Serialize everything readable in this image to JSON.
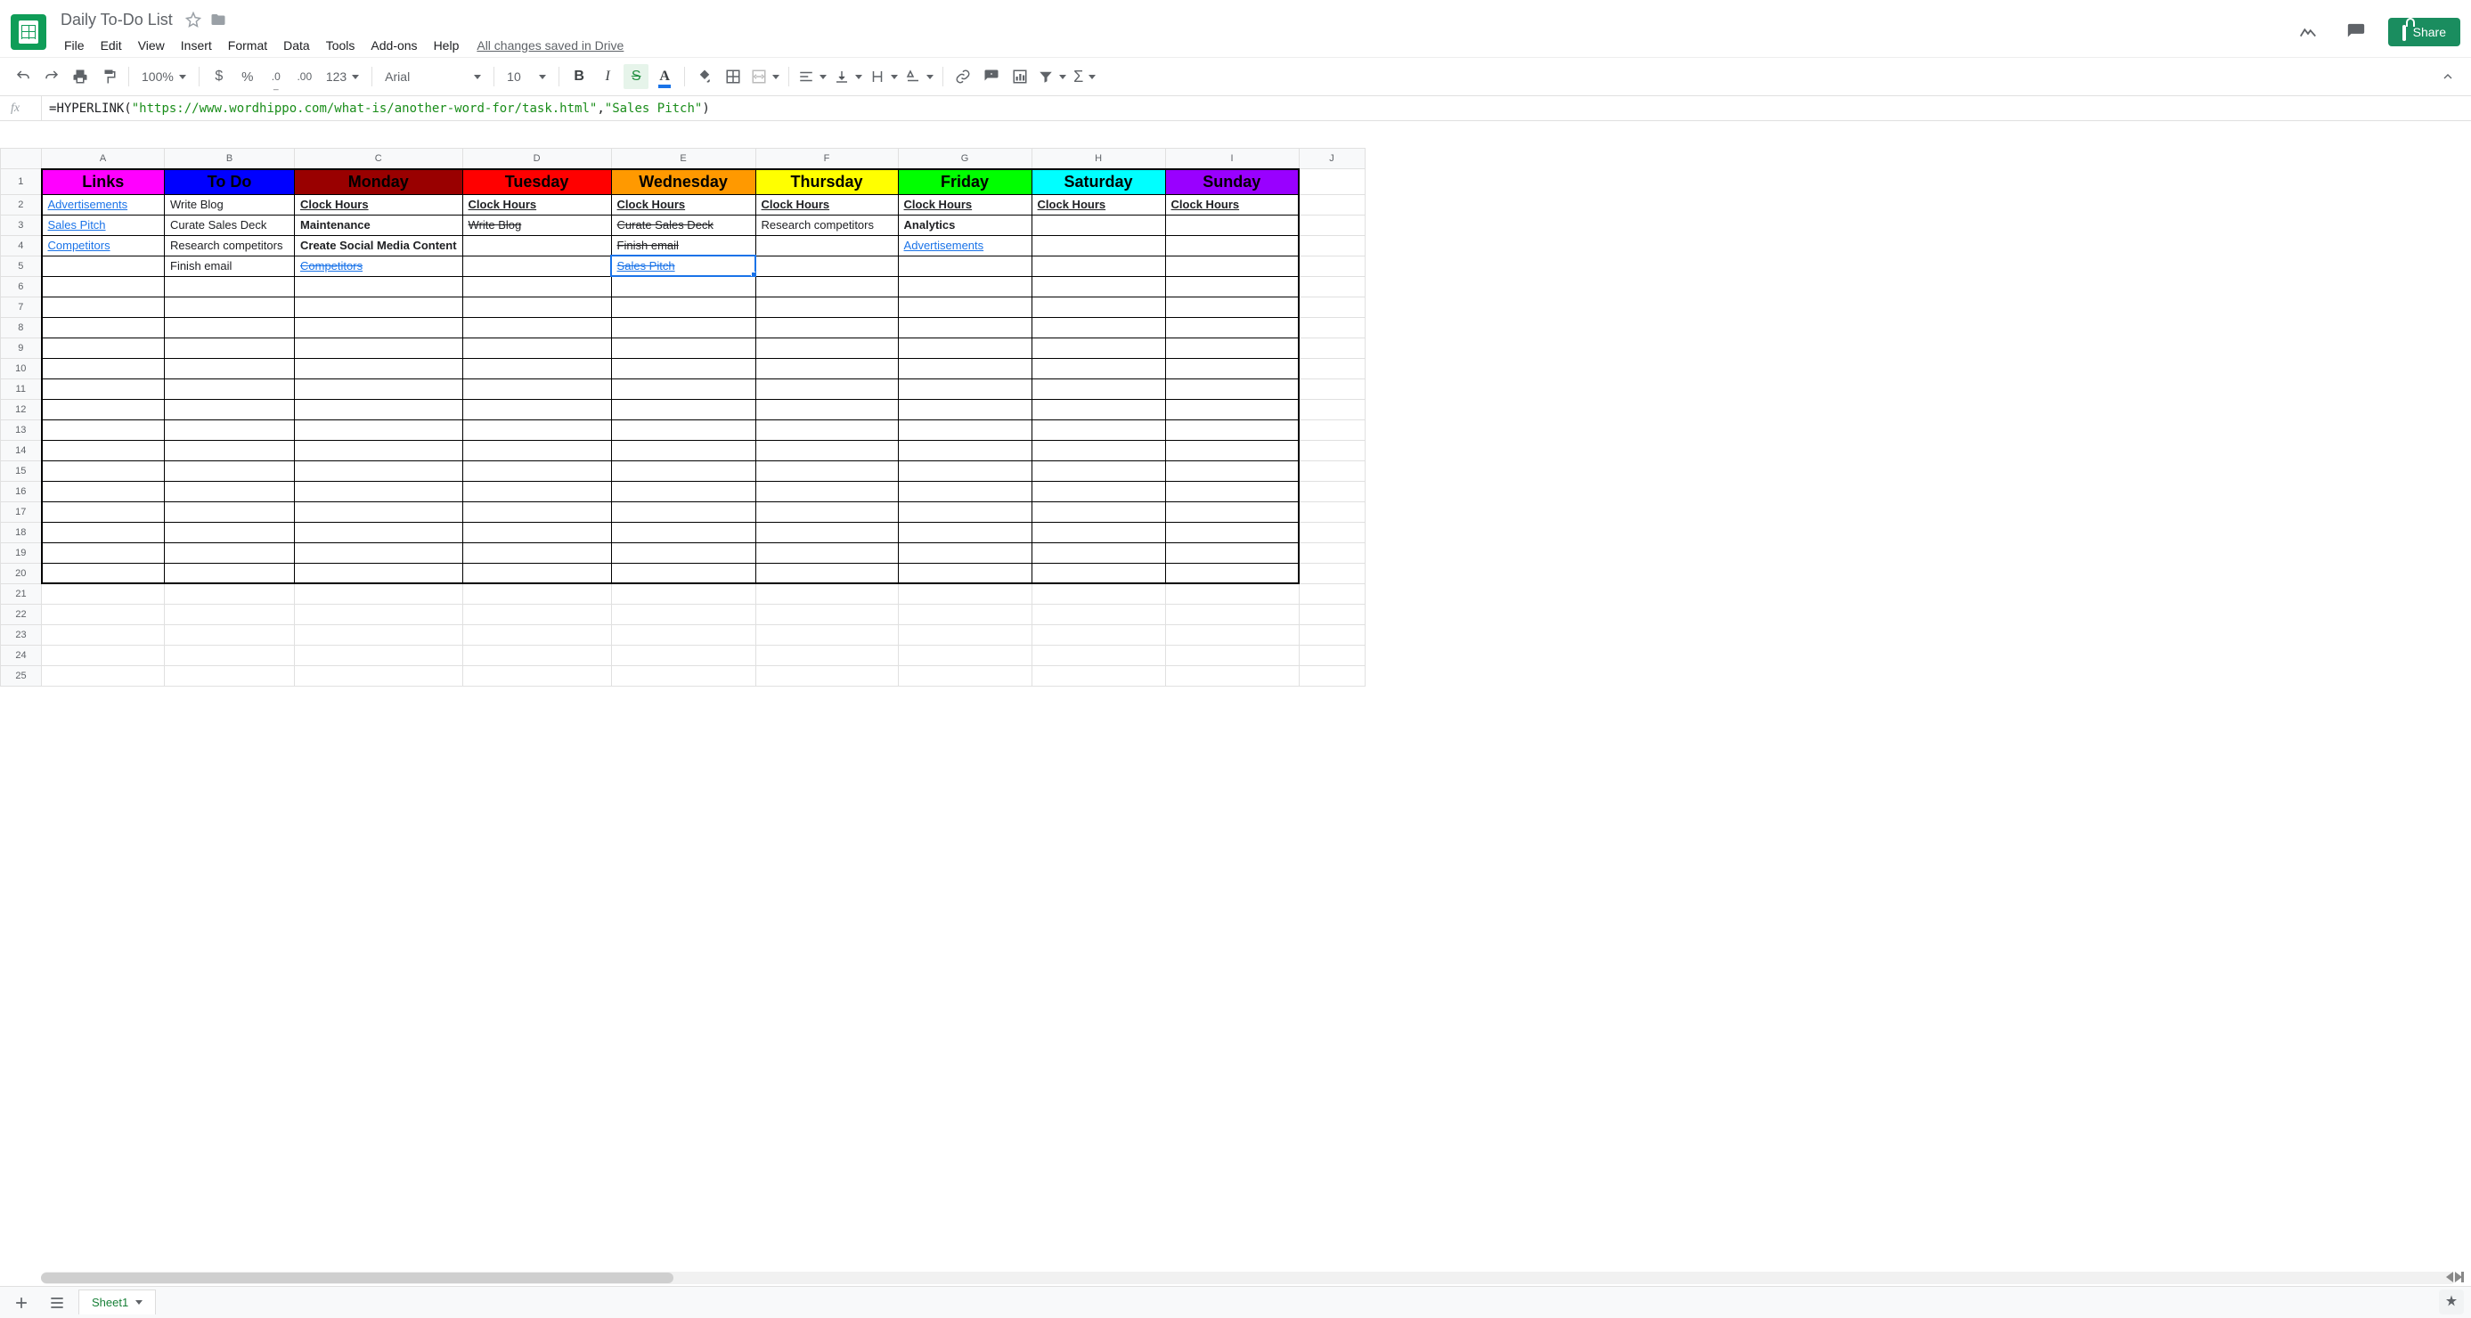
{
  "doc": {
    "title": "Daily To-Do List",
    "saved_msg": "All changes saved in Drive"
  },
  "menubar": [
    "File",
    "Edit",
    "View",
    "Insert",
    "Format",
    "Data",
    "Tools",
    "Add-ons",
    "Help"
  ],
  "share": {
    "label": "Share"
  },
  "toolbar": {
    "zoom": "100%",
    "font": "Arial",
    "font_size": "10",
    "more_formats": "123"
  },
  "formula": {
    "fn": "HYPERLINK",
    "arg1": "\"https://www.wordhippo.com/what-is/another-word-for/task.html\"",
    "arg2": "\"Sales Pitch\""
  },
  "columns": [
    "A",
    "B",
    "C",
    "D",
    "E",
    "F",
    "G",
    "H",
    "I",
    "J"
  ],
  "active": {
    "col": "E",
    "row": 5
  },
  "headers": {
    "A": {
      "text": "Links",
      "bg": "#ff00ff",
      "fg": "#000"
    },
    "B": {
      "text": "To Do",
      "bg": "#0000ff",
      "fg": "#000"
    },
    "C": {
      "text": "Monday",
      "bg": "#990000",
      "fg": "#000"
    },
    "D": {
      "text": "Tuesday",
      "bg": "#ff0000",
      "fg": "#000"
    },
    "E": {
      "text": "Wednesday",
      "bg": "#ff9900",
      "fg": "#000"
    },
    "F": {
      "text": "Thursday",
      "bg": "#ffff00",
      "fg": "#000"
    },
    "G": {
      "text": "Friday",
      "bg": "#00ff00",
      "fg": "#000"
    },
    "H": {
      "text": "Saturday",
      "bg": "#00ffff",
      "fg": "#000"
    },
    "I": {
      "text": "Sunday",
      "bg": "#9900ff",
      "fg": "#000"
    }
  },
  "rows": [
    {
      "n": 2,
      "A": {
        "t": "Advertisements",
        "link": true
      },
      "B": {
        "t": "Write Blog"
      },
      "C": {
        "t": "Clock Hours",
        "bold": true,
        "ul": true
      },
      "D": {
        "t": "Clock Hours",
        "bold": true,
        "ul": true
      },
      "E": {
        "t": "Clock Hours",
        "bold": true,
        "ul": true
      },
      "F": {
        "t": "Clock Hours",
        "bold": true,
        "ul": true
      },
      "G": {
        "t": "Clock Hours",
        "bold": true,
        "ul": true
      },
      "H": {
        "t": "Clock Hours",
        "bold": true,
        "ul": true
      },
      "I": {
        "t": "Clock Hours",
        "bold": true,
        "ul": true
      }
    },
    {
      "n": 3,
      "A": {
        "t": "Sales Pitch",
        "link": true
      },
      "B": {
        "t": "Curate Sales Deck"
      },
      "C": {
        "t": "Maintenance",
        "bold": true
      },
      "D": {
        "t": "Write Blog",
        "strike": true
      },
      "E": {
        "t": "Curate Sales Deck",
        "strike": true
      },
      "F": {
        "t": "Research competitors"
      },
      "G": {
        "t": "Analytics",
        "bold": true
      }
    },
    {
      "n": 4,
      "A": {
        "t": "Competitors",
        "link": true
      },
      "B": {
        "t": "Research competitors"
      },
      "C": {
        "t": "Create Social Media Content",
        "bold": true
      },
      "E": {
        "t": "Finish email",
        "strike": true
      },
      "G": {
        "t": "Advertisements",
        "link": true
      }
    },
    {
      "n": 5,
      "B": {
        "t": "Finish email"
      },
      "C": {
        "t": "Competitors",
        "link": true,
        "strike": true
      },
      "E": {
        "t": "Sales Pitch",
        "link": true,
        "strike": true
      }
    }
  ],
  "sheet_tab": "Sheet1"
}
